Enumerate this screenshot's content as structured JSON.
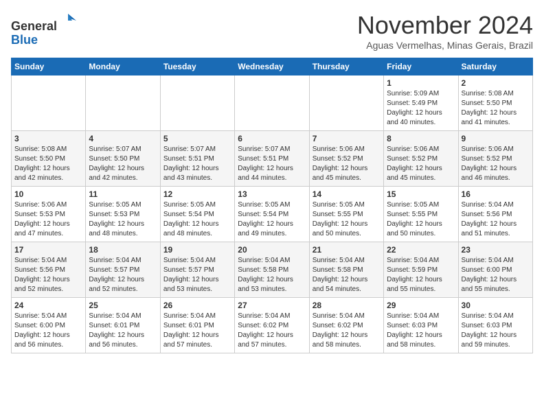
{
  "header": {
    "logo_line1": "General",
    "logo_line2": "Blue",
    "month_title": "November 2024",
    "location": "Aguas Vermelhas, Minas Gerais, Brazil"
  },
  "weekdays": [
    "Sunday",
    "Monday",
    "Tuesday",
    "Wednesday",
    "Thursday",
    "Friday",
    "Saturday"
  ],
  "weeks": [
    [
      {
        "day": "",
        "sunrise": "",
        "sunset": "",
        "daylight": ""
      },
      {
        "day": "",
        "sunrise": "",
        "sunset": "",
        "daylight": ""
      },
      {
        "day": "",
        "sunrise": "",
        "sunset": "",
        "daylight": ""
      },
      {
        "day": "",
        "sunrise": "",
        "sunset": "",
        "daylight": ""
      },
      {
        "day": "",
        "sunrise": "",
        "sunset": "",
        "daylight": ""
      },
      {
        "day": "1",
        "sunrise": "5:09 AM",
        "sunset": "5:49 PM",
        "daylight": "12 hours and 40 minutes."
      },
      {
        "day": "2",
        "sunrise": "5:08 AM",
        "sunset": "5:50 PM",
        "daylight": "12 hours and 41 minutes."
      }
    ],
    [
      {
        "day": "3",
        "sunrise": "5:08 AM",
        "sunset": "5:50 PM",
        "daylight": "12 hours and 42 minutes."
      },
      {
        "day": "4",
        "sunrise": "5:07 AM",
        "sunset": "5:50 PM",
        "daylight": "12 hours and 42 minutes."
      },
      {
        "day": "5",
        "sunrise": "5:07 AM",
        "sunset": "5:51 PM",
        "daylight": "12 hours and 43 minutes."
      },
      {
        "day": "6",
        "sunrise": "5:07 AM",
        "sunset": "5:51 PM",
        "daylight": "12 hours and 44 minutes."
      },
      {
        "day": "7",
        "sunrise": "5:06 AM",
        "sunset": "5:52 PM",
        "daylight": "12 hours and 45 minutes."
      },
      {
        "day": "8",
        "sunrise": "5:06 AM",
        "sunset": "5:52 PM",
        "daylight": "12 hours and 45 minutes."
      },
      {
        "day": "9",
        "sunrise": "5:06 AM",
        "sunset": "5:52 PM",
        "daylight": "12 hours and 46 minutes."
      }
    ],
    [
      {
        "day": "10",
        "sunrise": "5:06 AM",
        "sunset": "5:53 PM",
        "daylight": "12 hours and 47 minutes."
      },
      {
        "day": "11",
        "sunrise": "5:05 AM",
        "sunset": "5:53 PM",
        "daylight": "12 hours and 48 minutes."
      },
      {
        "day": "12",
        "sunrise": "5:05 AM",
        "sunset": "5:54 PM",
        "daylight": "12 hours and 48 minutes."
      },
      {
        "day": "13",
        "sunrise": "5:05 AM",
        "sunset": "5:54 PM",
        "daylight": "12 hours and 49 minutes."
      },
      {
        "day": "14",
        "sunrise": "5:05 AM",
        "sunset": "5:55 PM",
        "daylight": "12 hours and 50 minutes."
      },
      {
        "day": "15",
        "sunrise": "5:05 AM",
        "sunset": "5:55 PM",
        "daylight": "12 hours and 50 minutes."
      },
      {
        "day": "16",
        "sunrise": "5:04 AM",
        "sunset": "5:56 PM",
        "daylight": "12 hours and 51 minutes."
      }
    ],
    [
      {
        "day": "17",
        "sunrise": "5:04 AM",
        "sunset": "5:56 PM",
        "daylight": "12 hours and 52 minutes."
      },
      {
        "day": "18",
        "sunrise": "5:04 AM",
        "sunset": "5:57 PM",
        "daylight": "12 hours and 52 minutes."
      },
      {
        "day": "19",
        "sunrise": "5:04 AM",
        "sunset": "5:57 PM",
        "daylight": "12 hours and 53 minutes."
      },
      {
        "day": "20",
        "sunrise": "5:04 AM",
        "sunset": "5:58 PM",
        "daylight": "12 hours and 53 minutes."
      },
      {
        "day": "21",
        "sunrise": "5:04 AM",
        "sunset": "5:58 PM",
        "daylight": "12 hours and 54 minutes."
      },
      {
        "day": "22",
        "sunrise": "5:04 AM",
        "sunset": "5:59 PM",
        "daylight": "12 hours and 55 minutes."
      },
      {
        "day": "23",
        "sunrise": "5:04 AM",
        "sunset": "6:00 PM",
        "daylight": "12 hours and 55 minutes."
      }
    ],
    [
      {
        "day": "24",
        "sunrise": "5:04 AM",
        "sunset": "6:00 PM",
        "daylight": "12 hours and 56 minutes."
      },
      {
        "day": "25",
        "sunrise": "5:04 AM",
        "sunset": "6:01 PM",
        "daylight": "12 hours and 56 minutes."
      },
      {
        "day": "26",
        "sunrise": "5:04 AM",
        "sunset": "6:01 PM",
        "daylight": "12 hours and 57 minutes."
      },
      {
        "day": "27",
        "sunrise": "5:04 AM",
        "sunset": "6:02 PM",
        "daylight": "12 hours and 57 minutes."
      },
      {
        "day": "28",
        "sunrise": "5:04 AM",
        "sunset": "6:02 PM",
        "daylight": "12 hours and 58 minutes."
      },
      {
        "day": "29",
        "sunrise": "5:04 AM",
        "sunset": "6:03 PM",
        "daylight": "12 hours and 58 minutes."
      },
      {
        "day": "30",
        "sunrise": "5:04 AM",
        "sunset": "6:03 PM",
        "daylight": "12 hours and 59 minutes."
      }
    ]
  ]
}
